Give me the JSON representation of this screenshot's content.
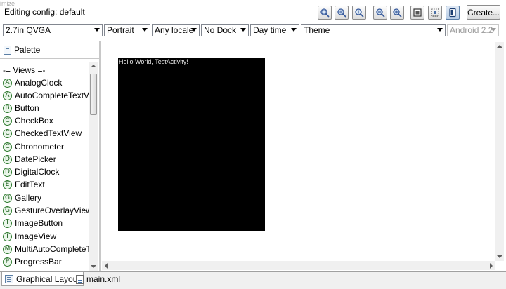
{
  "header": {
    "ghost_text": "imize",
    "config_title": "Editing config: default",
    "create_label": "Create..."
  },
  "toolbar_icons": [
    "zoom-real-size-icon",
    "zoom-fit-icon",
    "zoom-100-icon",
    "zoom-out-icon",
    "zoom-in-icon",
    "clip-to-screen-icon",
    "show-layout-bounds-icon",
    "device-frame-icon"
  ],
  "config_bar": {
    "device": "2.7in QVGA",
    "orientation": "Portrait",
    "locale": "Any locale",
    "dock": "No Dock",
    "time": "Day time",
    "theme": "Theme",
    "target": "Android 2.2"
  },
  "palette": {
    "title": "Palette",
    "group": "-= Views =-",
    "items": [
      {
        "letter": "A",
        "label": "AnalogClock"
      },
      {
        "letter": "A",
        "label": "AutoCompleteTextView"
      },
      {
        "letter": "B",
        "label": "Button"
      },
      {
        "letter": "C",
        "label": "CheckBox"
      },
      {
        "letter": "C",
        "label": "CheckedTextView"
      },
      {
        "letter": "C",
        "label": "Chronometer"
      },
      {
        "letter": "D",
        "label": "DatePicker"
      },
      {
        "letter": "D",
        "label": "DigitalClock"
      },
      {
        "letter": "E",
        "label": "EditText"
      },
      {
        "letter": "G",
        "label": "Gallery"
      },
      {
        "letter": "G",
        "label": "GestureOverlayView"
      },
      {
        "letter": "I",
        "label": "ImageButton"
      },
      {
        "letter": "I",
        "label": "ImageView"
      },
      {
        "letter": "M",
        "label": "MultiAutoCompleteTextView"
      },
      {
        "letter": "P",
        "label": "ProgressBar"
      }
    ]
  },
  "canvas": {
    "screen_text": "Hello World, TestActivity!"
  },
  "tabs": {
    "graphical": "Graphical Layout",
    "xml": "main.xml"
  }
}
